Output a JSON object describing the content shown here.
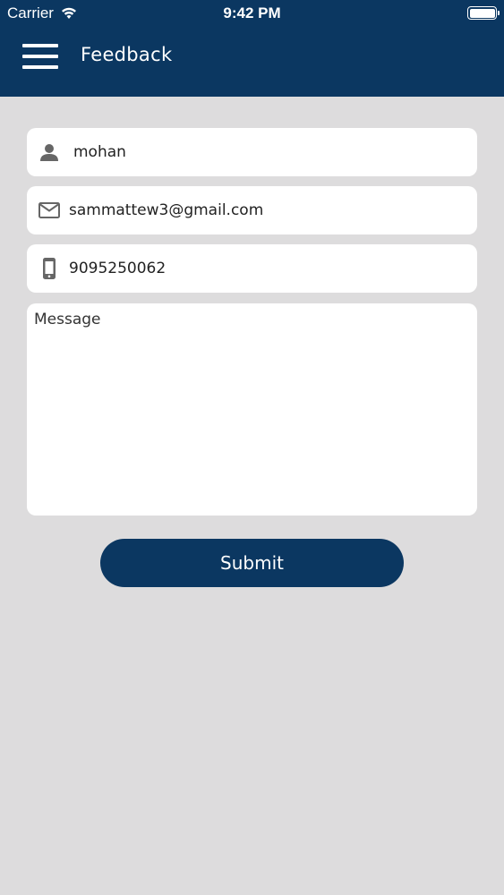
{
  "status_bar": {
    "carrier": "Carrier",
    "time": "9:42 PM",
    "battery_level": 1.0
  },
  "header": {
    "title": "Feedback",
    "menu_icon": "hamburger-icon",
    "background_color": "#0b3761"
  },
  "form": {
    "name": {
      "icon": "person-icon",
      "value": "mohan"
    },
    "email": {
      "icon": "envelope-icon",
      "value": "sammattew3@gmail.com"
    },
    "phone": {
      "icon": "phone-icon",
      "value": "9095250062"
    },
    "message": {
      "placeholder": "Message",
      "value": ""
    },
    "submit_label": "Submit"
  },
  "colors": {
    "accent": "#0b3761",
    "background": "#dddcdd",
    "icon": "#666666"
  }
}
